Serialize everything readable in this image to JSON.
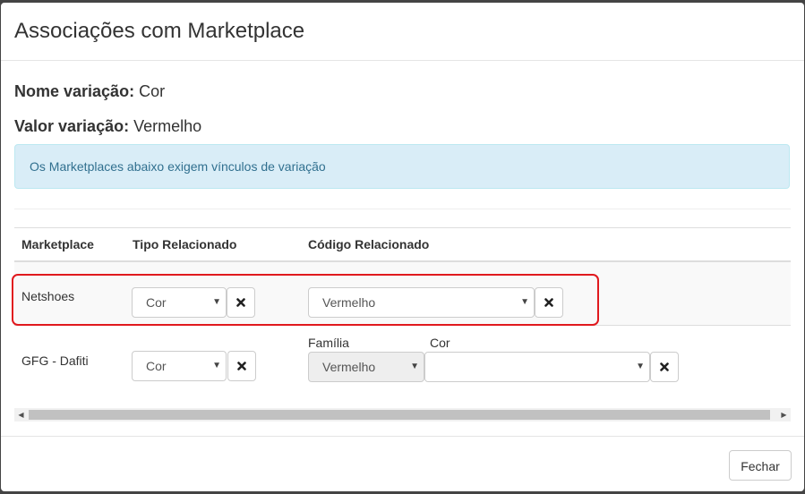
{
  "modal": {
    "title": "Associações com Marketplace",
    "variation_name_label": "Nome variação:",
    "variation_name_value": "Cor",
    "variation_value_label": "Valor variação:",
    "variation_value_value": "Vermelho",
    "alert_text": "Os Marketplaces abaixo exigem vínculos de variação",
    "close_label": "Fechar"
  },
  "table": {
    "headers": [
      "Marketplace",
      "Tipo Relacionado",
      "Código Relacionado"
    ],
    "rows": [
      {
        "marketplace": "Netshoes",
        "tipo_value": "Cor",
        "codigo_value": "Vermelho"
      },
      {
        "marketplace": "GFG - Dafiti",
        "tipo_value": "Cor",
        "familia_label": "Família",
        "familia_value": "Vermelho",
        "cor_label": "Cor",
        "cor_value": ""
      }
    ]
  },
  "colors": {
    "highlight": "#e0191e",
    "alert_bg": "#d9edf7",
    "alert_text": "#31708f"
  },
  "icons": {
    "remove": "close-icon",
    "dropdown": "caret-down-icon"
  }
}
